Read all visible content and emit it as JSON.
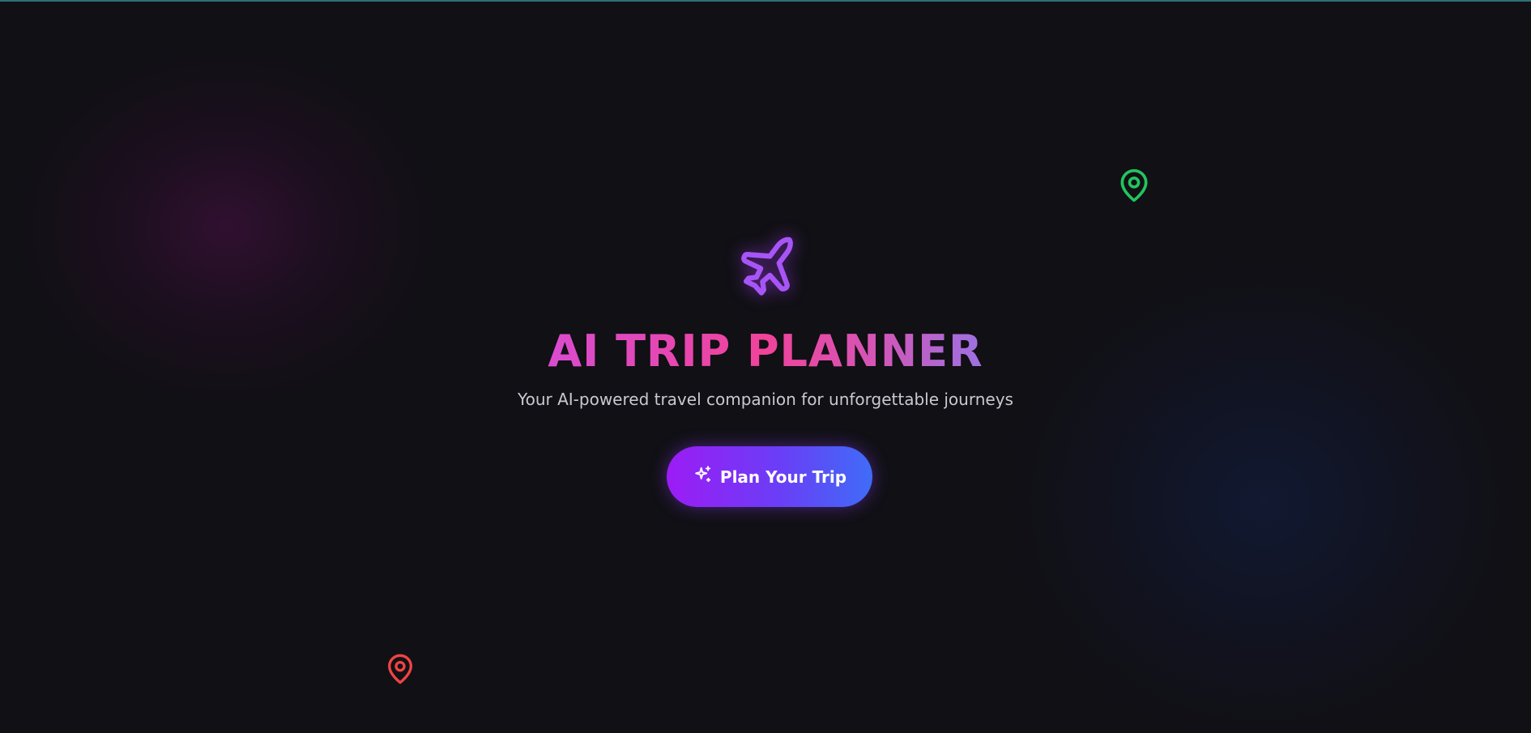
{
  "hero": {
    "icon": "airplane-icon",
    "title": "AI TRIP PLANNER",
    "subtitle": "Your AI-powered travel companion for unforgettable journeys",
    "cta_label": "Plan Your Trip",
    "cta_icon": "sparkles-icon"
  },
  "decorations": {
    "pins": [
      {
        "icon": "map-pin-icon",
        "color": "#22c55e"
      },
      {
        "icon": "map-pin-icon",
        "color": "#ef4444"
      }
    ]
  },
  "colors": {
    "background": "#111015",
    "accent_purple": "#a855f7",
    "title_gradient_start": "#d946c8",
    "title_gradient_mid": "#ec4899",
    "title_gradient_end": "#a66ee0",
    "button_gradient_start": "#9c1cf5",
    "button_gradient_end": "#3f6cf7"
  }
}
